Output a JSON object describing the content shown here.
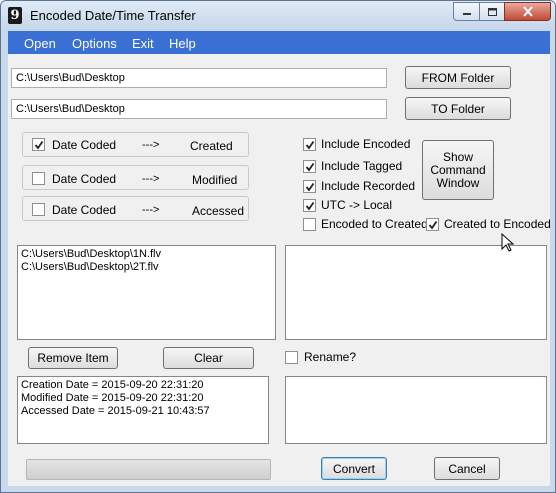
{
  "window": {
    "title": "Encoded Date/Time Transfer",
    "app_icon_glyph": "9"
  },
  "menu": {
    "items": [
      "Open",
      "Options",
      "Exit",
      "Help"
    ]
  },
  "paths": {
    "from_path": "C:\\Users\\Bud\\Desktop",
    "to_path": "C:\\Users\\Bud\\Desktop",
    "from_button": "FROM Folder",
    "to_button": "TO Folder"
  },
  "mappings": [
    {
      "label": "Date Coded",
      "arrow": "--->",
      "target": "Created",
      "checked": true
    },
    {
      "label": "Date Coded",
      "arrow": "--->",
      "target": "Modified",
      "checked": false
    },
    {
      "label": "Date Coded",
      "arrow": "--->",
      "target": "Accessed",
      "checked": false
    }
  ],
  "options": {
    "include_encoded": {
      "label": "Include Encoded",
      "checked": true
    },
    "include_tagged": {
      "label": "Include Tagged",
      "checked": true
    },
    "include_recorded": {
      "label": "Include Recorded",
      "checked": true
    },
    "utc_local": {
      "label": "UTC -> Local",
      "checked": true
    },
    "encoded_to_created": {
      "label": "Encoded to Created",
      "checked": false
    },
    "created_to_encoded": {
      "label": "Created to Encoded",
      "checked": true
    }
  },
  "show_command_button": {
    "line1": "Show",
    "line2": "Command",
    "line3": "Window"
  },
  "files": {
    "items": [
      "C:\\Users\\Bud\\Desktop\\1N.flv",
      "C:\\Users\\Bud\\Desktop\\2T.flv"
    ]
  },
  "actions": {
    "remove_item": "Remove Item",
    "clear": "Clear",
    "rename": {
      "label": "Rename?",
      "checked": false
    }
  },
  "details": {
    "lines": [
      "Creation Date = 2015-09-20 22:31:20",
      "Modified Date = 2015-09-20 22:31:20",
      "Accessed Date = 2015-09-21 10:43:57"
    ]
  },
  "footer": {
    "convert": "Convert",
    "cancel": "Cancel",
    "progress": 0
  },
  "colors": {
    "menubar": "#3a6fd3",
    "close_button": "#c24a34",
    "frame": "#c9d9ec"
  }
}
